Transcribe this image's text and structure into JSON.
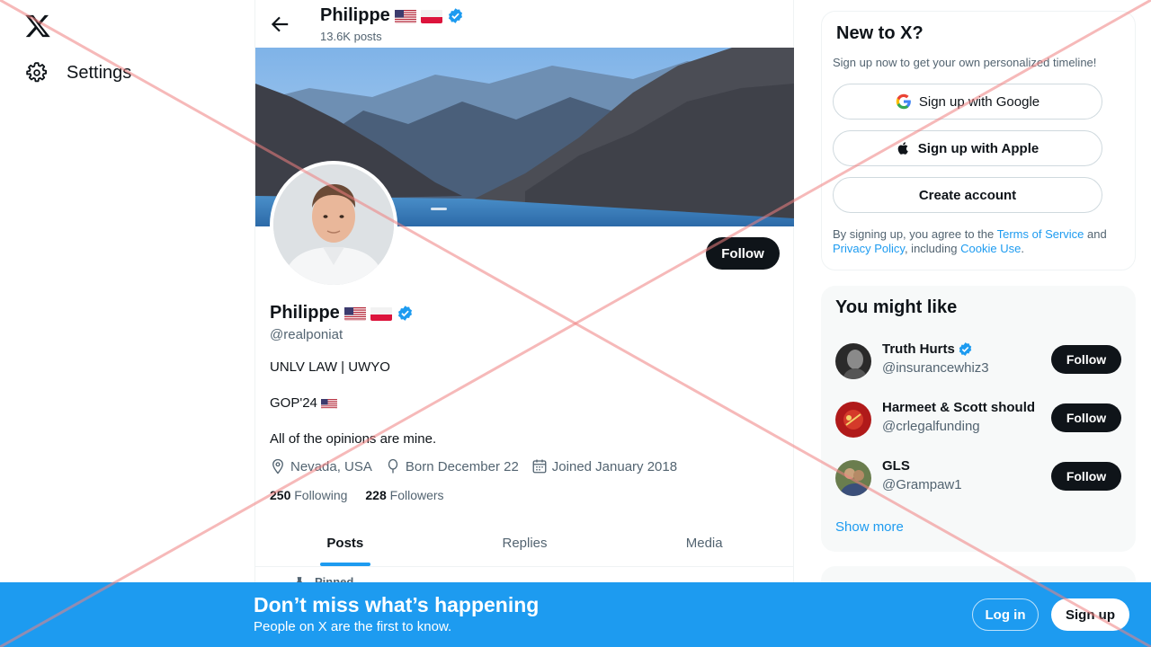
{
  "nav": {
    "settings_label": "Settings"
  },
  "profile": {
    "name": "Philippe",
    "posts_count": "13.6K posts",
    "handle": "@realponiat",
    "bio_line1": "UNLV LAW | UWYO",
    "bio_line2": "GOP'24",
    "bio_line3": "All of the opinions are mine.",
    "location": "Nevada, USA",
    "birthday": "Born December 22",
    "joined": "Joined January 2018",
    "following_count": "250",
    "following_label": "Following",
    "followers_count": "228",
    "followers_label": "Followers",
    "follow_label": "Follow",
    "tabs": [
      "Posts",
      "Replies",
      "Media"
    ],
    "pinned_label": "Pinned"
  },
  "signup_card": {
    "title": "New to X?",
    "subtitle": "Sign up now to get your own personalized timeline!",
    "google_label": "Sign up with Google",
    "apple_label": "Sign up with Apple",
    "create_label": "Create account",
    "legal_prefix": "By signing up, you agree to the ",
    "terms": "Terms of Service",
    "and": " and ",
    "privacy": "Privacy Policy",
    "including": ", including ",
    "cookie": "Cookie Use",
    "period": "."
  },
  "suggestions": {
    "title": "You might like",
    "items": [
      {
        "name": "Truth Hurts",
        "handle": "@insurancewhiz3",
        "verified": true,
        "follow": "Follow"
      },
      {
        "name": "Harmeet & Scott should",
        "handle": "@crlegalfunding",
        "verified": false,
        "follow": "Follow"
      },
      {
        "name": "GLS",
        "handle": "@Grampaw1",
        "verified": false,
        "follow": "Follow"
      }
    ],
    "show_more": "Show more"
  },
  "bottom_bar": {
    "title": "Don’t miss what’s happening",
    "subtitle": "People on X are the first to know.",
    "login": "Log in",
    "signup": "Sign up"
  },
  "colors": {
    "accent": "#1d9bf0",
    "text": "#0f1419",
    "muted": "#536471",
    "overlay_x": "#f08080"
  }
}
